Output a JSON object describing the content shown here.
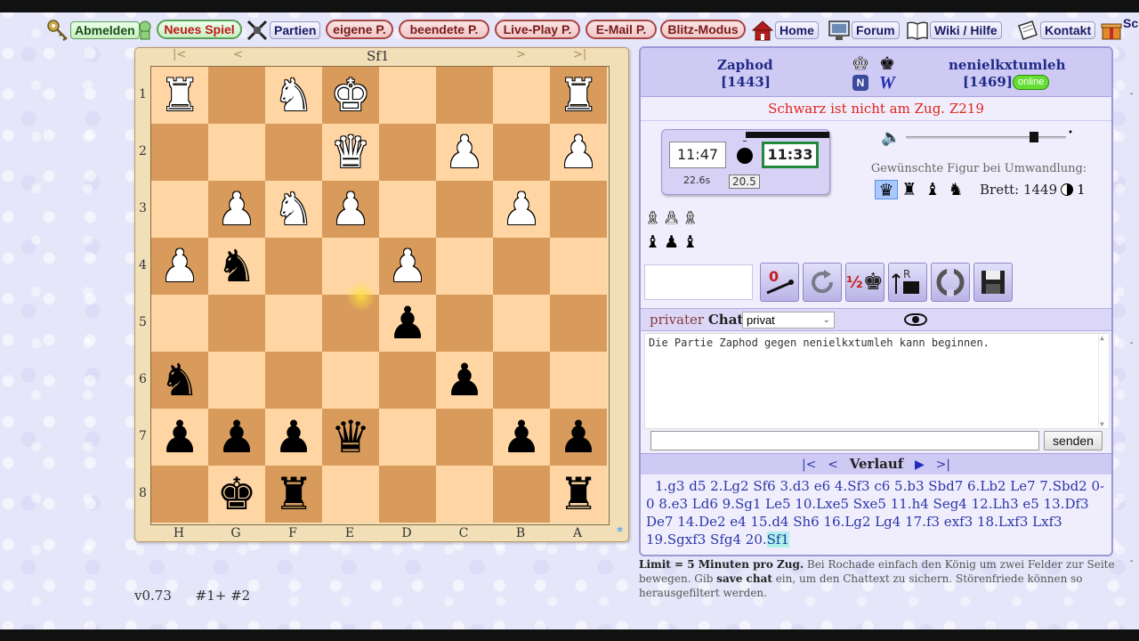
{
  "nav": {
    "logout": "Abmelden",
    "new_game": "Neues Spiel",
    "games": "Partien",
    "own": "eigene P.",
    "finished": "beendete P.",
    "liveplay": "Live-Play P.",
    "email": "E-Mail P.",
    "blitz": "Blitz-Modus",
    "home": "Home",
    "forum": "Forum",
    "wiki": "Wiki / Hilfe",
    "contact": "Kontakt",
    "extra": "Sc"
  },
  "board": {
    "last_move": "Sf1",
    "nav": [
      "|<",
      "<",
      ">",
      ">|"
    ],
    "rank_labels": [
      "1",
      "2",
      "3",
      "4",
      "5",
      "6",
      "7",
      "8"
    ],
    "file_labels": [
      "H",
      "G",
      "F",
      "E",
      "D",
      "C",
      "B",
      "A"
    ],
    "star": "*",
    "rows": [
      [
        "wR",
        "",
        "wN",
        "wK",
        "",
        "",
        "",
        "wR"
      ],
      [
        "",
        "",
        "",
        "wQ",
        "",
        "wP",
        "",
        "wP"
      ],
      [
        "",
        "wP",
        "wN",
        "wP",
        "",
        "",
        "wP",
        ""
      ],
      [
        "wP",
        "bN",
        "",
        "",
        "wP",
        "",
        "",
        ""
      ],
      [
        "",
        "",
        "",
        "",
        "bP",
        "",
        "",
        ""
      ],
      [
        "bN",
        "",
        "",
        "",
        "",
        "bP",
        "",
        ""
      ],
      [
        "bP",
        "bP",
        "bP",
        "bQ",
        "",
        "",
        "bP",
        "bP"
      ],
      [
        "",
        "bK",
        "bR",
        "",
        "",
        "",
        "",
        "bR"
      ]
    ]
  },
  "players": {
    "white": {
      "name": "Zaphod",
      "rating": "[1443]"
    },
    "black": {
      "name": "nenielkxtumleh",
      "rating": "[1469]",
      "status": "online"
    },
    "badge_n": "N",
    "badge_w": "W"
  },
  "status_text": "Schwarz ist nicht am Zug. Z219",
  "clock": {
    "white_time": "11:47",
    "black_time": "11:33",
    "white_sub": "22.6s",
    "black_sub": "20.5"
  },
  "volume": {
    "level": 0.8
  },
  "promotion": {
    "label": "Gewünschte Figur bei Umwandlung:",
    "pieces": [
      "♛",
      "♜",
      "♝",
      "♞"
    ],
    "brett_label": "Brett: 1449",
    "brett_count": "1"
  },
  "captured": {
    "white": "♗♙♗",
    "black": "♝♟♝"
  },
  "actions": {
    "resign_label": "0",
    "draw_label": "½"
  },
  "chat": {
    "label_prefix": "privater",
    "label_bold": "Chat",
    "select_value": "privat",
    "message": "Die Partie Zaphod gegen nenielkxtumleh kann beginnen.",
    "send": "senden"
  },
  "verlauf": {
    "title": "Verlauf",
    "first": "|<",
    "prev": "<",
    "next": "|",
    "last": ">|",
    "moves": "1.g3 d5 2.Lg2 Sf6 3.d3 e6 4.Sf3 c6 5.b3 Sbd7 6.Lb2 Le7 7.Sbd2 0-0 8.e3 Ld6 9.Sg1 Le5 10.Lxe5 Sxe5 11.h4 Seg4 12.Lh3 e5 13.Df3 De7 14.De2 e4 15.d4 Sh6 16.Lg2 Lg4 17.f3 exf3 18.Lxf3 Lxf3 19.Sgxf3 Sfg4 20.",
    "last_move": "Sf1"
  },
  "limit": {
    "bold": "Limit = 5 Minuten pro Zug.",
    "text1": " Bei Rochade einfach den König um zwei Felder zur Seite bewegen. Gib ",
    "bold2": "save chat",
    "text2": " ein, um den Chattext zu sichern. Störenfriede können so herausgefiltert werden."
  },
  "footer": {
    "version": "v0.73",
    "ids": "#1+ #2"
  },
  "colors": {
    "light_square": "#ffd6a3",
    "dark_square": "#d89b5c",
    "status_red": "#e2231a",
    "player_blue": "#1f2a88",
    "online_green": "#66dd33"
  }
}
